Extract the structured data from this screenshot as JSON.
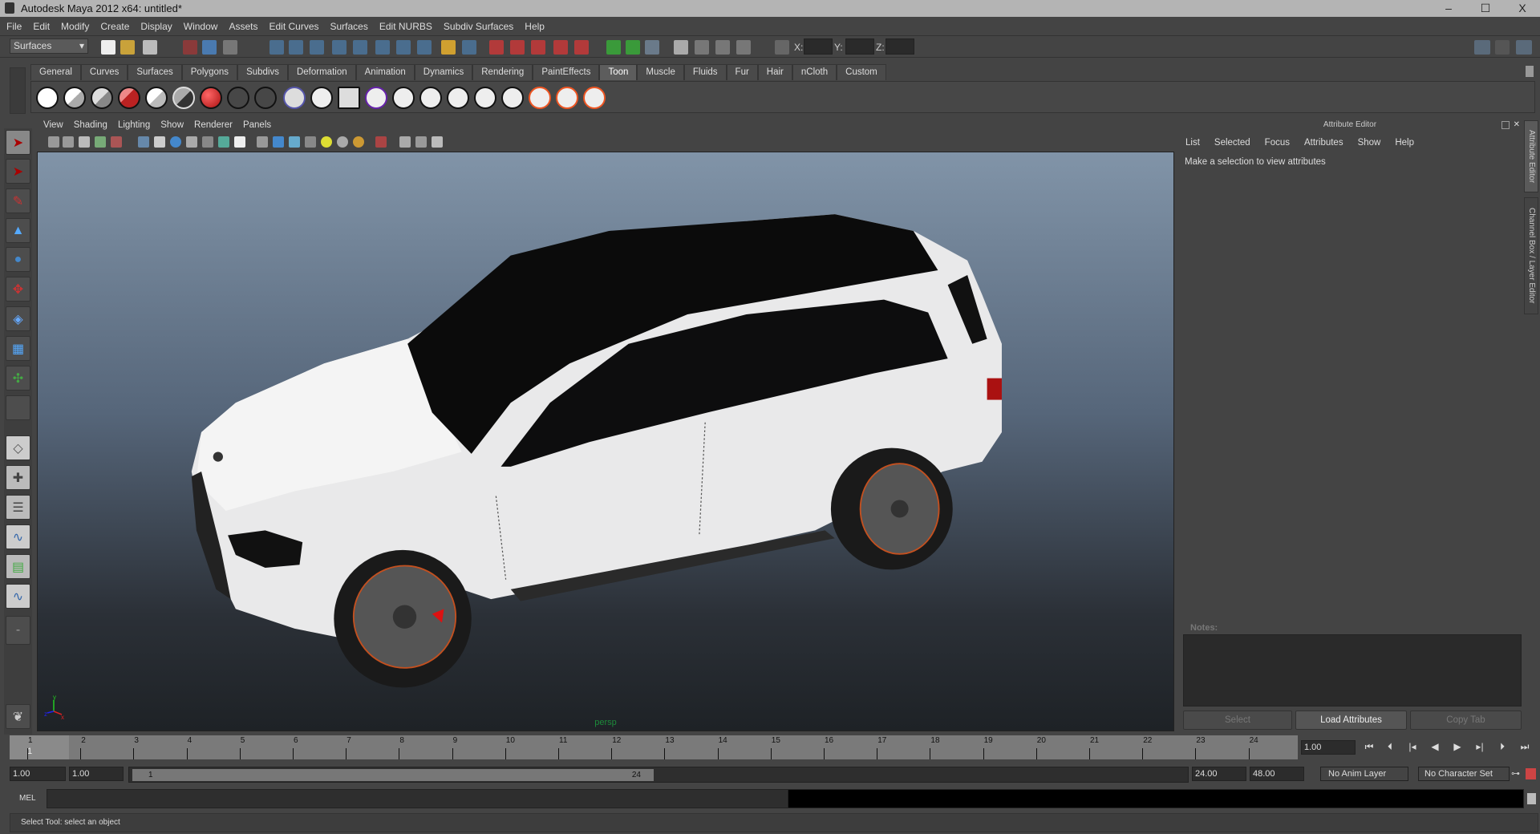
{
  "window": {
    "title": "Autodesk Maya 2012 x64: untitled*",
    "minimize": "–",
    "maximize": "☐",
    "close": "X"
  },
  "menubar": [
    "File",
    "Edit",
    "Modify",
    "Create",
    "Display",
    "Window",
    "Assets",
    "Edit Curves",
    "Surfaces",
    "Edit NURBS",
    "Subdiv Surfaces",
    "Help"
  ],
  "toolbar": {
    "mode": "Surfaces",
    "x_label": "X:",
    "y_label": "Y:",
    "z_label": "Z:"
  },
  "shelf": {
    "tabs": [
      "General",
      "Curves",
      "Surfaces",
      "Polygons",
      "Subdivs",
      "Deformation",
      "Animation",
      "Dynamics",
      "Rendering",
      "PaintEffects",
      "Toon",
      "Muscle",
      "Fluids",
      "Fur",
      "Hair",
      "nCloth",
      "Custom"
    ],
    "active_tab": "Toon"
  },
  "panel": {
    "menu": [
      "View",
      "Shading",
      "Lighting",
      "Show",
      "Renderer",
      "Panels"
    ],
    "camera": "persp",
    "axis_y": "y",
    "axis_x": "x",
    "axis_z": "z"
  },
  "attribute_editor": {
    "title": "Attribute Editor",
    "menu": [
      "List",
      "Selected",
      "Focus",
      "Attributes",
      "Show",
      "Help"
    ],
    "message": "Make a selection to view attributes",
    "notes_label": "Notes:",
    "buttons": {
      "select": "Select",
      "load": "Load Attributes",
      "copy": "Copy Tab"
    }
  },
  "side_tabs": {
    "attribute_editor": "Attribute Editor",
    "channel_box": "Channel Box / Layer Editor"
  },
  "timeline": {
    "frames": [
      "1",
      "2",
      "3",
      "4",
      "5",
      "6",
      "7",
      "8",
      "9",
      "10",
      "11",
      "12",
      "13",
      "14",
      "15",
      "16",
      "17",
      "18",
      "19",
      "20",
      "21",
      "22",
      "23",
      "24"
    ],
    "current_frame": "1",
    "current_time": "1.00"
  },
  "range": {
    "start": "1.00",
    "playback_start": "1.00",
    "slider_start": "1",
    "slider_end": "24",
    "playback_end": "24.00",
    "end": "48.00",
    "anim_layer": "No Anim Layer",
    "character_set": "No Character Set"
  },
  "command_line": {
    "label": "MEL"
  },
  "help_line": "Select Tool: select an object",
  "colors": {
    "viewport_top": "#8194a8",
    "viewport_bottom": "#1e2226",
    "accent_red": "#c0282a",
    "persp_green": "#1d8a3a"
  }
}
